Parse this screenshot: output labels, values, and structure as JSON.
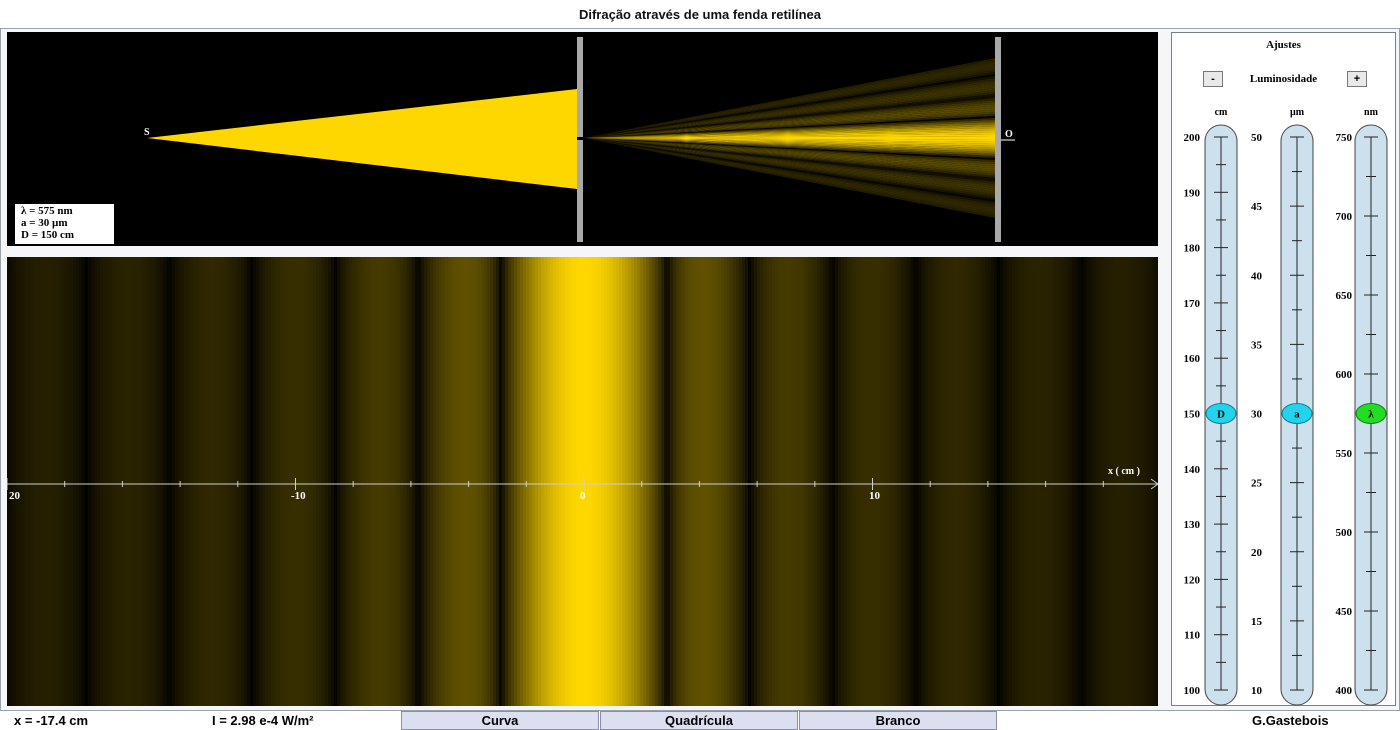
{
  "window": {
    "title": "Difração através de uma fenda retilínea"
  },
  "experiment": {
    "source_label": "S",
    "observation_label": "O",
    "params": {
      "lambda": "λ = 575 nm",
      "slit": "a = 30 µm",
      "distance": "D  = 150 cm"
    }
  },
  "pattern": {
    "axis_label": "x ( cm )",
    "x_min": -20,
    "x_max": 20,
    "tick_labels": [
      "20",
      "-10",
      "0",
      "10"
    ],
    "wavelength_nm": 575,
    "slit_um": 30,
    "distance_cm": 150,
    "color": "#ffd700"
  },
  "settings": {
    "title": "Ajustes",
    "luminosity": {
      "label": "Luminosidade",
      "minus": "-",
      "plus": "+"
    },
    "sliders": [
      {
        "unit": "cm",
        "handle": "D",
        "value": 150,
        "min": 100,
        "max": 200,
        "labels": [
          "200",
          "190",
          "180",
          "170",
          "160",
          "150",
          "140",
          "130",
          "120",
          "110",
          "100"
        ],
        "color": "#22d3ee"
      },
      {
        "unit": "µm",
        "handle": "a",
        "value": 30,
        "min": 10,
        "max": 50,
        "labels": [
          "50",
          "45",
          "40",
          "35",
          "30",
          "25",
          "20",
          "15",
          "10"
        ],
        "color": "#22d3ee"
      },
      {
        "unit": "nm",
        "handle": "λ",
        "value": 575,
        "min": 400,
        "max": 750,
        "labels": [
          "750",
          "700",
          "650",
          "600",
          "550",
          "500",
          "450",
          "400"
        ],
        "color": "#22dd22"
      }
    ]
  },
  "status": {
    "x_readout": "x = -17.4 cm",
    "intensity_readout": "I = 2.98 e-4 W/m²",
    "buttons": {
      "curve": "Curva",
      "grid": "Quadrícula",
      "white": "Branco"
    },
    "author": "G.Gastebois"
  }
}
